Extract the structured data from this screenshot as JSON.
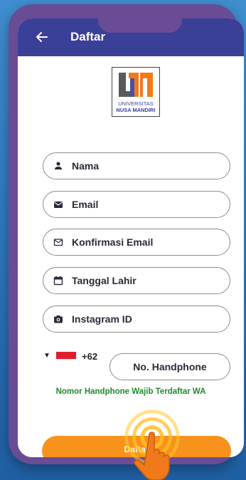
{
  "appbar": {
    "title": "Daftar",
    "back_icon": "arrow-left-icon"
  },
  "logo": {
    "line1": "UNIVERSITAS",
    "line2": "NUSA MANDIRI"
  },
  "form": {
    "fields": [
      {
        "label": "Nama",
        "icon": "person-icon"
      },
      {
        "label": "Email",
        "icon": "envelope-filled-icon"
      },
      {
        "label": "Konfirmasi Email",
        "icon": "envelope-outline-icon"
      },
      {
        "label": "Tanggal Lahir",
        "icon": "calendar-icon"
      },
      {
        "label": "Instagram ID",
        "icon": "camera-icon"
      }
    ],
    "country_code": "+62",
    "phone_label": "No. Handphone",
    "wa_note": "Nomor Handphone Wajib Terdaftar WA",
    "submit_label": "Daftar"
  },
  "colors": {
    "appbar": "#3a3f98",
    "button": "#f7931d",
    "note": "#1f8a2a",
    "frame": "#6a4c95"
  }
}
